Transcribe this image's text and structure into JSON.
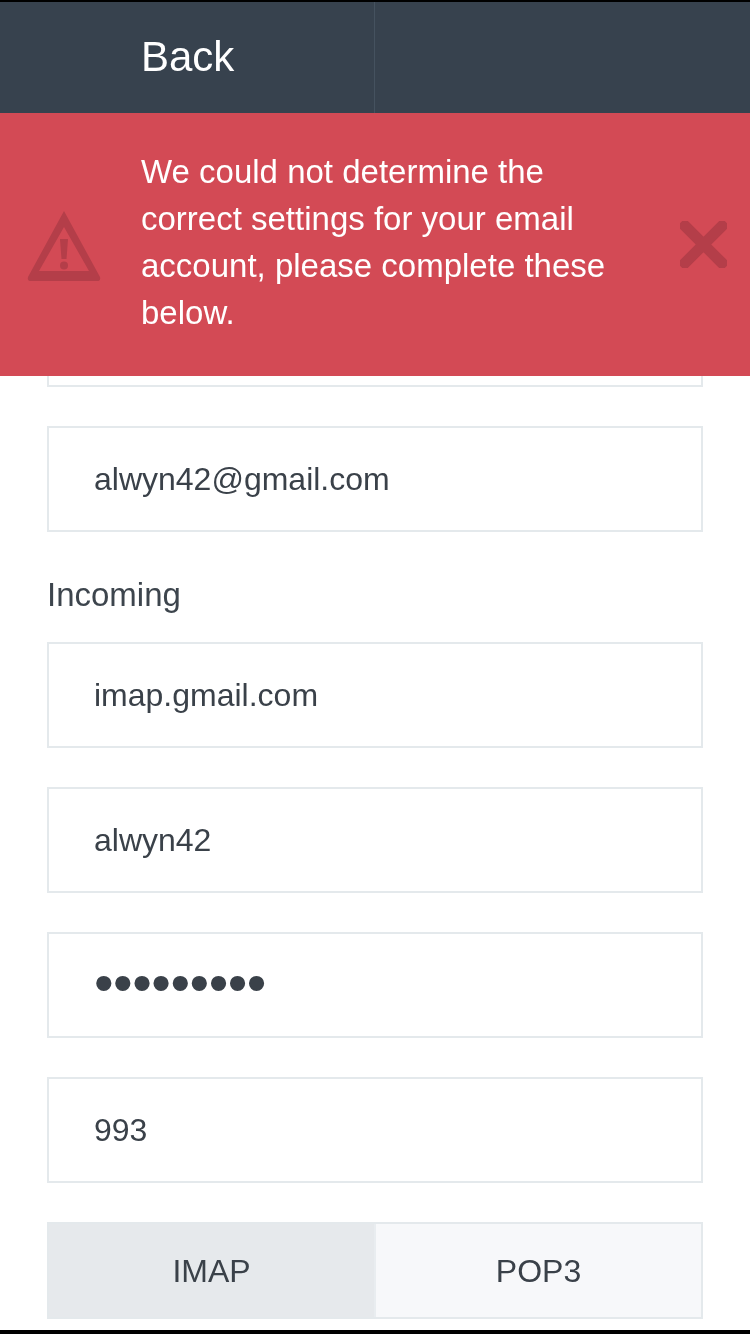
{
  "header": {
    "back_label": "Back"
  },
  "alert": {
    "message": "We could not determine the correct settings for your email account, please complete these below."
  },
  "form": {
    "items": [
      {
        "kind": "field"
      },
      {
        "kind": "field",
        "value": "alwyn42@gmail.com"
      },
      {
        "kind": "label",
        "text": "Incoming"
      },
      {
        "kind": "field",
        "value": "imap.gmail.com"
      },
      {
        "kind": "field",
        "value": "alwyn42"
      },
      {
        "kind": "password",
        "value": "•••••••••"
      },
      {
        "kind": "field",
        "value": "993"
      },
      {
        "kind": "segmented",
        "options": [
          {
            "label": "IMAP",
            "selected": true
          },
          {
            "label": "POP3",
            "selected": false
          }
        ]
      }
    ]
  }
}
